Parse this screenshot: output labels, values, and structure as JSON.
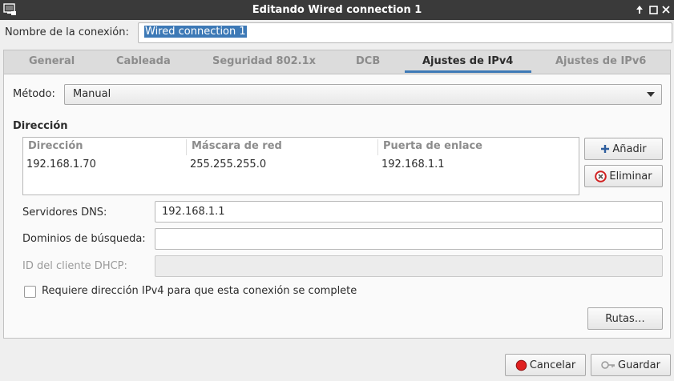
{
  "window": {
    "title": "Editando Wired connection 1",
    "icon": "network-settings-icon"
  },
  "connection_name": {
    "label": "Nombre de la conexión:",
    "value": "Wired connection 1"
  },
  "tabs": [
    {
      "label": "General"
    },
    {
      "label": "Cableada"
    },
    {
      "label": "Seguridad 802.1x"
    },
    {
      "label": "DCB"
    },
    {
      "label": "Ajustes de IPv4",
      "active": true
    },
    {
      "label": "Ajustes de IPv6"
    }
  ],
  "ipv4": {
    "method_label": "Método:",
    "method_value": "Manual",
    "section_title": "Dirección",
    "table": {
      "headers": [
        "Dirección",
        "Máscara de red",
        "Puerta de enlace"
      ],
      "rows": [
        [
          "192.168.1.70",
          "255.255.255.0",
          "192.168.1.1"
        ]
      ]
    },
    "add_button": "Añadir",
    "remove_button": "Eliminar",
    "dns_label": "Servidores DNS:",
    "dns_value": "192.168.1.1",
    "search_label": "Dominios de búsqueda:",
    "search_value": "",
    "dhcp_label": "ID del cliente DHCP:",
    "dhcp_value": "",
    "require_label": "Requiere dirección IPv4 para que esta conexión se complete",
    "require_checked": false,
    "routes_button": "Rutas…"
  },
  "footer": {
    "cancel": "Cancelar",
    "save": "Guardar"
  },
  "colors": {
    "accent": "#3d79b6",
    "titlebar": "#3a3a3a",
    "cancel_icon": "#e02020"
  }
}
